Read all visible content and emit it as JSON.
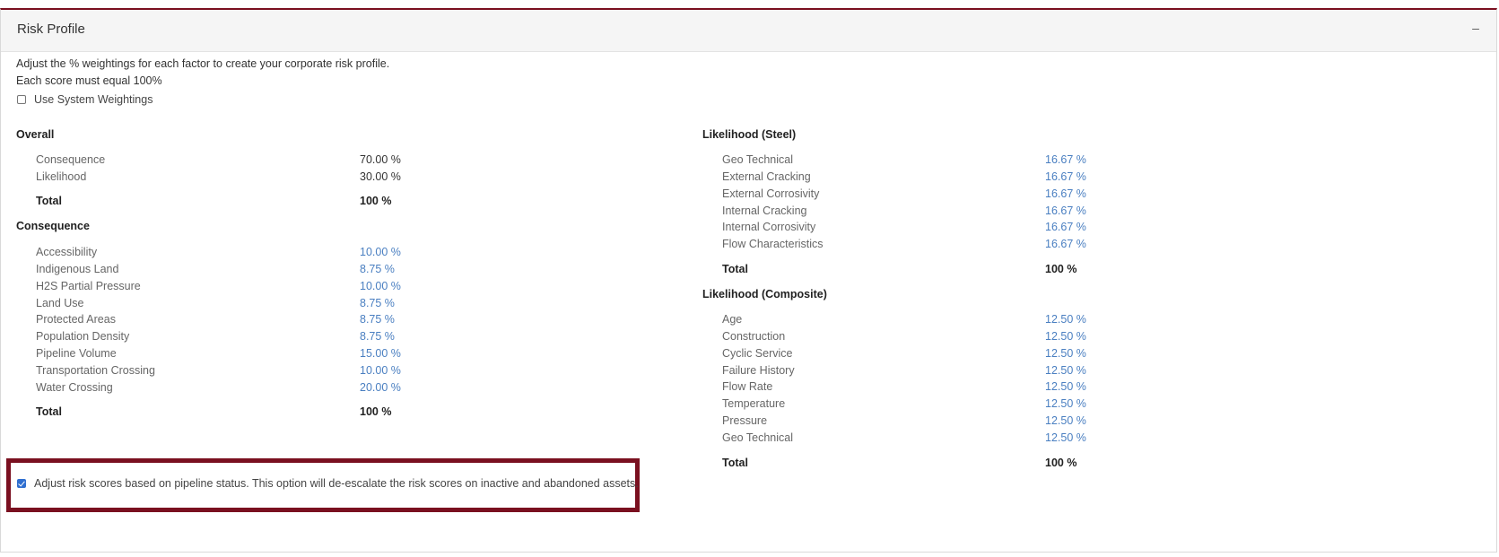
{
  "panel": {
    "title": "Risk Profile",
    "collapse_symbol": "–"
  },
  "intro": {
    "line1": "Adjust the % weightings for each factor to create your corporate risk profile.",
    "line2": "Each score must equal 100%"
  },
  "system_weightings": {
    "label": "Use System Weightings",
    "checked": false
  },
  "overall": {
    "title": "Overall",
    "rows": [
      {
        "label": "Consequence",
        "value": "70.00 %"
      },
      {
        "label": "Likelihood",
        "value": "30.00 %"
      }
    ],
    "total_label": "Total",
    "total_value": "100 %"
  },
  "consequence": {
    "title": "Consequence",
    "rows": [
      {
        "label": "Accessibility",
        "value": "10.00 %"
      },
      {
        "label": "Indigenous Land",
        "value": "8.75 %"
      },
      {
        "label": "H2S Partial Pressure",
        "value": "10.00 %"
      },
      {
        "label": "Land Use",
        "value": "8.75 %"
      },
      {
        "label": "Protected Areas",
        "value": "8.75 %"
      },
      {
        "label": "Population Density",
        "value": "8.75 %"
      },
      {
        "label": "Pipeline Volume",
        "value": "15.00 %"
      },
      {
        "label": "Transportation Crossing",
        "value": "10.00 %"
      },
      {
        "label": "Water Crossing",
        "value": "20.00 %"
      }
    ],
    "total_label": "Total",
    "total_value": "100 %"
  },
  "likelihood_steel": {
    "title": "Likelihood (Steel)",
    "rows": [
      {
        "label": "Geo Technical",
        "value": "16.67 %"
      },
      {
        "label": "External Cracking",
        "value": "16.67 %"
      },
      {
        "label": "External Corrosivity",
        "value": "16.67 %"
      },
      {
        "label": "Internal Cracking",
        "value": "16.67 %"
      },
      {
        "label": "Internal Corrosivity",
        "value": "16.67 %"
      },
      {
        "label": "Flow Characteristics",
        "value": "16.67 %"
      }
    ],
    "total_label": "Total",
    "total_value": "100 %"
  },
  "likelihood_composite": {
    "title": "Likelihood (Composite)",
    "rows": [
      {
        "label": "Age",
        "value": "12.50 %"
      },
      {
        "label": "Construction",
        "value": "12.50 %"
      },
      {
        "label": "Cyclic Service",
        "value": "12.50 %"
      },
      {
        "label": "Failure History",
        "value": "12.50 %"
      },
      {
        "label": "Flow Rate",
        "value": "12.50 %"
      },
      {
        "label": "Temperature",
        "value": "12.50 %"
      },
      {
        "label": "Pressure",
        "value": "12.50 %"
      },
      {
        "label": "Geo Technical",
        "value": "12.50 %"
      }
    ],
    "total_label": "Total",
    "total_value": "100 %"
  },
  "pipeline_status": {
    "label": "Adjust risk scores based on pipeline status. This option will de-escalate the risk scores on inactive and abandoned assets.",
    "checked": true
  },
  "colors": {
    "accent": "#7a1020",
    "link": "#4a7fc1",
    "checkbox": "#2f6fd0"
  }
}
